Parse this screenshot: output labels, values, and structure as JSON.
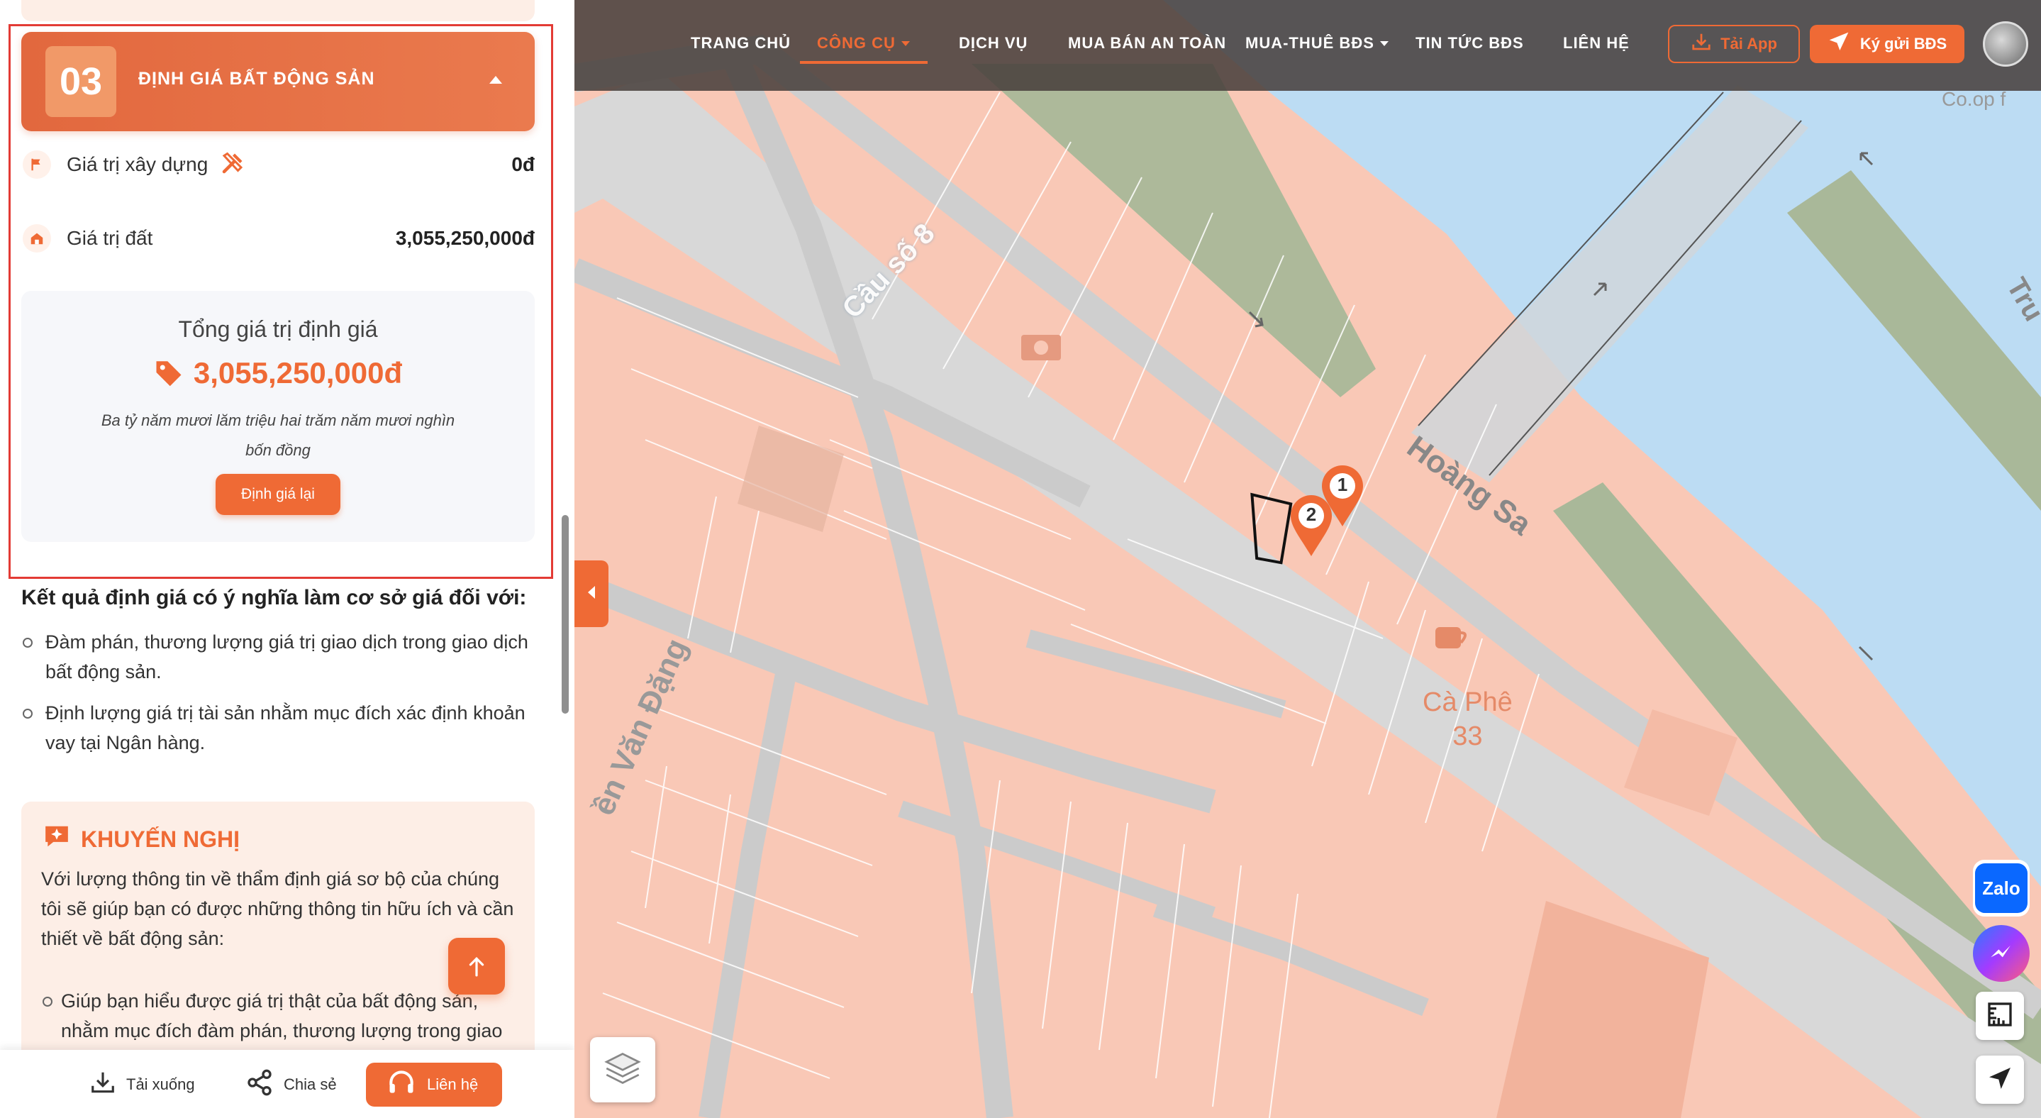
{
  "valuation": {
    "step_number": "03",
    "title": "ĐỊNH GIÁ BẤT ĐỘNG SẢN",
    "construction_label": "Giá trị xây dựng",
    "construction_value": "0đ",
    "land_label": "Giá trị đất",
    "land_value": "3,055,250,000đ",
    "total_title": "Tổng giá trị định giá",
    "total_amount": "3,055,250,000đ",
    "total_words": "Ba tỷ năm mươi lăm triệu hai trăm năm mươi nghìn bốn đồng",
    "recalc_label": "Định giá lại"
  },
  "result": {
    "heading": "Kết quả định giá có ý nghĩa làm cơ sở giá đối với:",
    "items": [
      "Đàm phán, thương lượng giá trị giao dịch trong giao dịch bất động sản.",
      "Định lượng giá trị tài sản nhằm mục đích xác định khoản vay tại Ngân hàng."
    ]
  },
  "recommendation": {
    "heading": "KHUYẾN NGHỊ",
    "text": "Với lượng thông tin về thẩm định giá sơ bộ của chúng tôi sẽ giúp bạn có được những thông tin hữu ích và cần thiết về bất động sản:",
    "items": [
      "Giúp bạn hiểu được giá trị thật của bất động sản, nhằm mục đích đàm phán, thương lượng trong giao"
    ]
  },
  "bottom_bar": {
    "download": "Tải xuống",
    "share": "Chia sẻ",
    "contact": "Liên hệ"
  },
  "nav": {
    "home": "TRANG CHỦ",
    "tools": "CÔNG CỤ",
    "services": "DỊCH VỤ",
    "safe_trade": "MUA BÁN AN TOÀN",
    "buy_rent": "MUA-THUÊ BĐS",
    "news": "TIN TỨC BĐS",
    "contact": "LIÊN HỆ",
    "download_app": "Tải App",
    "deposit": "Ký gửi BĐS"
  },
  "map": {
    "labels": {
      "bridge": "Cầu số 8",
      "street_main": "Hoàng Sa",
      "street_left": "ền Văn Đặng",
      "cafe": "Cà Phê",
      "cafe_num": "33",
      "corner_top_right": "Tru",
      "coop": "Co.op f"
    },
    "markers": [
      "1",
      "2"
    ]
  },
  "chat": {
    "zalo": "Zalo"
  },
  "colors": {
    "accent": "#ef6a35",
    "map_land": "#f9c8b6",
    "water": "#bcdcf3",
    "park": "#a9b899"
  },
  "icons": {
    "flag": "flag-icon",
    "tools": "tools-icon",
    "house": "house-icon",
    "tag": "price-tag-icon",
    "spark": "sparkle-icon",
    "download": "download-icon",
    "share": "share-icon",
    "headset": "headset-icon",
    "layers": "layers-icon",
    "ruler": "ruler-icon",
    "locate": "locate-icon"
  }
}
